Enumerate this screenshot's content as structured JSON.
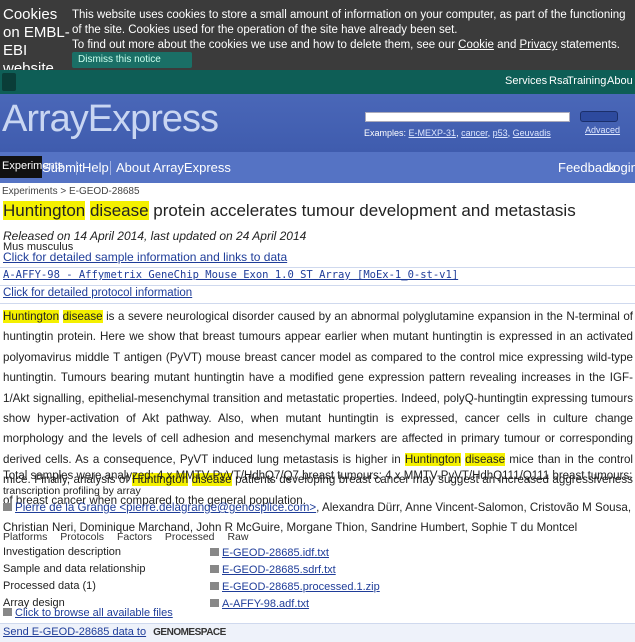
{
  "cookie": {
    "title": "Cookies on EMBL-EBI website",
    "line1": "This website uses cookies to store a small amount of information on your computer, as part of the functioning of the site. Cookies used for the operation of the site have already been set.",
    "line2_prefix": "To find out more about the cookies we use and how to delete them, see our",
    "cookie_link": "Cookie",
    "and": "and",
    "privacy_link": "Privacy",
    "statements": "statements.",
    "dismiss_label": "Dismiss this notice"
  },
  "topnav": {
    "services": "Services",
    "research": "Rsa",
    "training": "Training",
    "about": "Abou"
  },
  "masthead": {
    "brand": "ArrayExpress",
    "search_placeholder": "",
    "examples_label": "Examples:",
    "examples": [
      "E-MEXP-31",
      "cancer",
      "p53",
      "Geuvadis"
    ],
    "advanced": "Advaced"
  },
  "localnav": {
    "experiments": "Experiments",
    "submit": "Submit",
    "help": "Help",
    "about": "About ArrayExpress",
    "feedback": "Feedback",
    "login": "Login"
  },
  "breadcrumb": "Experiments > E-GEOD-28685",
  "experiment": {
    "title_prefix": "",
    "title_hl1": "Huntington",
    "title_hl2": "disease",
    "title_rest": " protein accelerates tumour development and metastasis",
    "released": "Released on 14 April 2014, last updated on 24 April 2014",
    "organism": "Mus musculus",
    "samples_link": "Click for detailed sample information and links to data",
    "array_link": "A-AFFY-98 - Affymetrix GeneChip Mouse Exon 1.0 ST Array [MoEx-1_0-st-v1]",
    "protocol_link": "Click for detailed protocol information",
    "description": {
      "hl_a": "Huntington",
      "hl_b": "disease",
      "p1": " is a severe neurological disorder caused by an abnormal polyglutamine expansion in the N-terminal of huntingtin protein. Here we show that breast tumours appear earlier when mutant huntingtin is expressed in an activated polyomavirus middle T antigen (PyVT) mouse breast cancer model as compared to the control mice expressing wild-type huntingtin. Tumours bearing mutant huntingtin have a modified gene expression pattern revealing increases in the IGF-1/Akt signalling, epithelial-mesenchymal transition and metastatic properties. Indeed, polyQ-huntingtin expressing tumours show hyper-activation of Akt pathway. Also, when mutant huntingtin is expressed, cancer cells in culture change morphology and the levels of cell adhesion and mesenchymal markers are affected in primary tumour or corresponding derived cells. As a consequence, PyVT induced lung metastasis is higher in ",
      "hl_c": "Huntington",
      "hl_d": "disease",
      "p2": " mice than in the control mice. Finally, analysis of ",
      "hl_e": "Huntington",
      "hl_f": "disease",
      "p3": " patients developing breast cancer may suggest an increased aggressiveness of breast cancer when compared to the general population."
    },
    "total": "Total samples were analyzed: 4 x MMTV-PyVT/HdhQ7/Q7 breast tumours; 4 x MMTV-PyVT/HdhQ111/Q111 breast tumours;",
    "type": "transcription profiling by array",
    "contact_link": "Pierre de la Grange <pierre.delagrange@genosplice.com>",
    "authors": ", Alexandra Dürr, Anne Vincent-Salomon, Cristovão M Sousa, Christian Neri, Dominique Marchand, John R McGuire, Morgane Thion, Sandrine Humbert, Sophie T du Montcel"
  },
  "file_tabs": [
    "Platforms",
    "Protocols",
    "Factors",
    "Processed",
    "Raw"
  ],
  "files": [
    {
      "label": "Investigation description",
      "file": "E-GEOD-28685.idf.txt"
    },
    {
      "label": "Sample and data relationship",
      "file": "E-GEOD-28685.sdrf.txt"
    },
    {
      "label": "Processed data (1)",
      "file": "E-GEOD-28685.processed.1.zip"
    },
    {
      "label": "Array design",
      "file": "A-AFFY-98.adf.txt"
    }
  ],
  "browse": "Click to browse all available files",
  "genomespace": {
    "send": "Send E-GEOD-28685 data to",
    "logo": "GENOMESPACE"
  },
  "colors": {
    "banner": "#3b3b3b",
    "nav": "#0e5e56",
    "masthead": "#4a67b8",
    "localnav": "#5573c4",
    "highlight": "#f4f000",
    "link": "#1f3d99"
  }
}
